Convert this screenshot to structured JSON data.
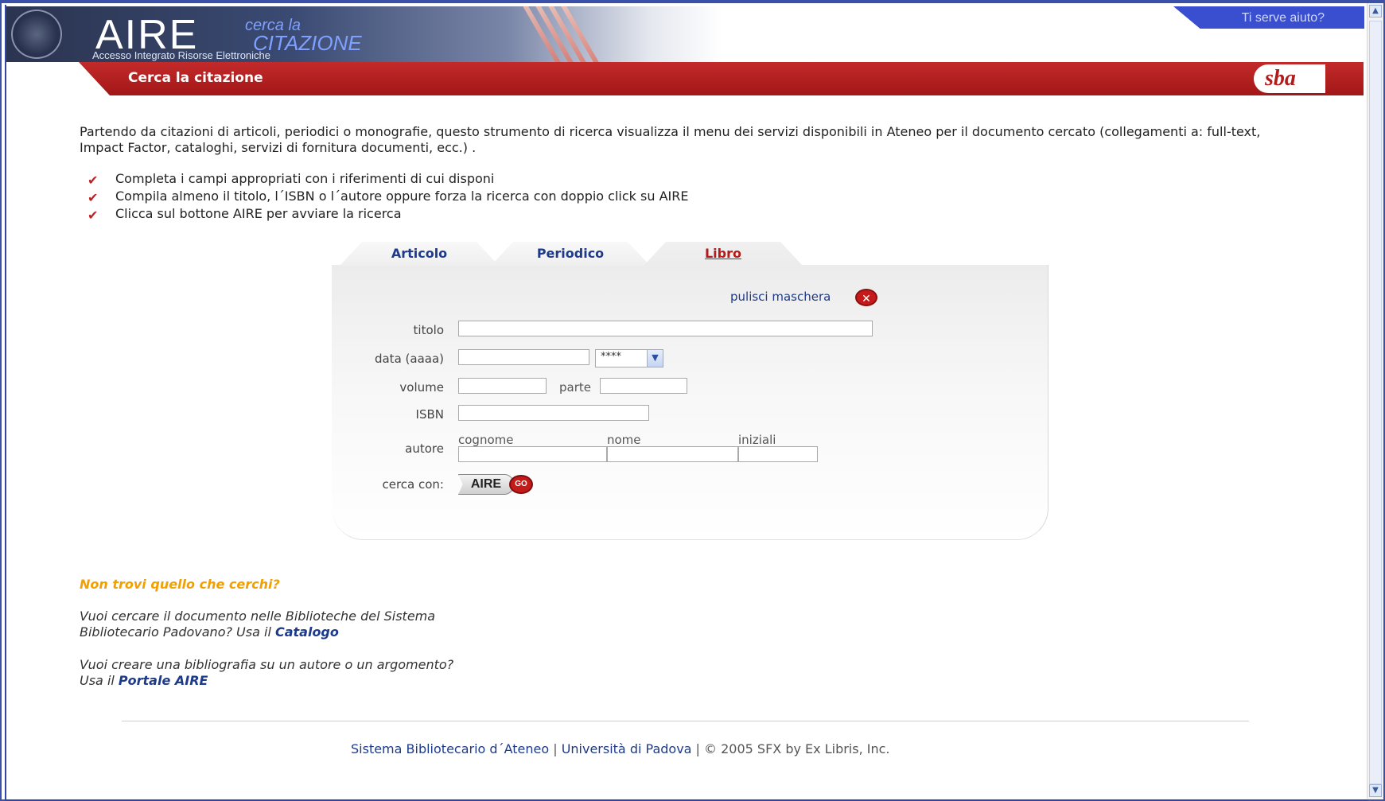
{
  "header": {
    "logo_title": "AIRE",
    "logo_sub1": "cerca la",
    "logo_sub2": "CITAZIONE",
    "logo_tagline": "Accesso Integrato Risorse Elettroniche",
    "help_link": "Ti serve aiuto?",
    "page_title": "Cerca la citazione",
    "sba_logo": "sba"
  },
  "intro": {
    "text": "Partendo da citazioni di articoli, periodici o monografie, questo strumento di ricerca visualizza il menu dei servizi disponibili in Ateneo per il documento cercato (collegamenti a: full-text, Impact Factor, cataloghi, servizi di fornitura documenti, ecc.) .",
    "bullets": [
      "Completa i campi appropriati con i riferimenti di cui disponi",
      "Compila almeno il titolo, l´ISBN o l´autore oppure forza la ricerca con doppio click su AIRE",
      "Clicca sul bottone AIRE per avviare la ricerca"
    ]
  },
  "tabs": [
    {
      "label": "Articolo",
      "active": false
    },
    {
      "label": "Periodico",
      "active": false
    },
    {
      "label": "Libro",
      "active": true
    }
  ],
  "form": {
    "clear_label": "pulisci maschera",
    "titolo_label": "titolo",
    "titolo_value": "",
    "data_label": "data (aaaa)",
    "data_value": "",
    "data_select_value": "****",
    "volume_label": "volume",
    "volume_value": "",
    "parte_label": "parte",
    "parte_value": "",
    "isbn_label": "ISBN",
    "isbn_value": "",
    "autore_label": "autore",
    "cognome_label": "cognome",
    "nome_label": "nome",
    "iniziali_label": "iniziali",
    "cognome_value": "",
    "nome_value": "",
    "iniziali_value": "",
    "cerca_label": "cerca con:",
    "aire_button": "AIRE",
    "go_label": "GO"
  },
  "help_section": {
    "heading": "Non trovi quello che cerchi?",
    "p1_text": "Vuoi cercare il documento nelle Biblioteche del Sistema",
    "p1_text2": "Bibliotecario Padovano? Usa il ",
    "p1_link": "Catalogo",
    "p2_text": "Vuoi creare una bibliografia su un autore o un argomento?",
    "p2_text2": "Usa il ",
    "p2_link": "Portale AIRE"
  },
  "footer": {
    "link1": "Sistema Bibliotecario d´Ateneo",
    "sep": " | ",
    "link2": "Università di Padova",
    "copyright": " | © 2005 SFX by Ex Libris, Inc."
  },
  "colors": {
    "red": "#b41a1a",
    "navy": "#1e3a8a",
    "orange": "#f0a000"
  }
}
